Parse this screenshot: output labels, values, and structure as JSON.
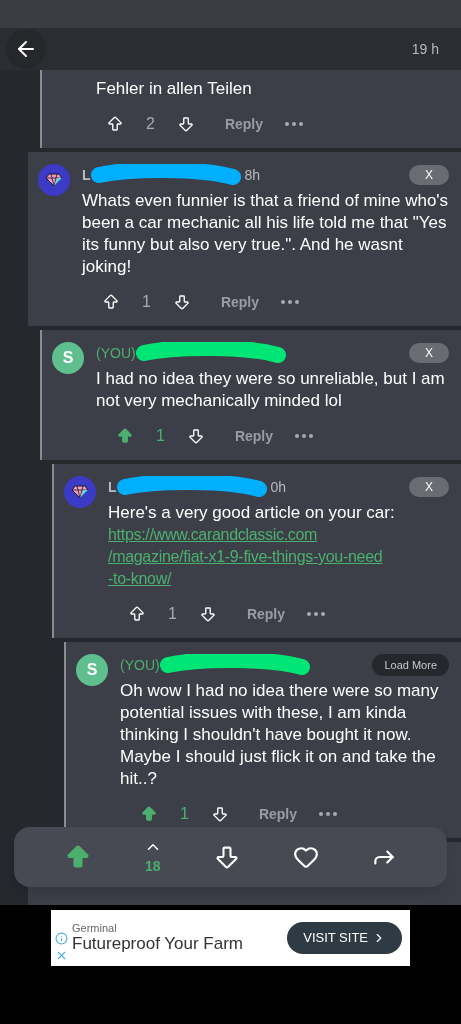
{
  "header": {
    "time": "19 h"
  },
  "earlier_thread": {
    "children": [
      {
        "text": "Fehler in allen Teilen",
        "votes": "2",
        "upvoted": false,
        "reply": "Reply"
      }
    ]
  },
  "comments": [
    {
      "avatar": {
        "kind": "diamond"
      },
      "author": "L",
      "time": "8h",
      "action": {
        "kind": "close",
        "label": "X"
      },
      "text": "Whats even funnier is that a friend of mine who's been a car mechanic all his life told me that \"Yes its funny but also very true.\". And he wasnt joking!",
      "votes": "1",
      "upvoted": false,
      "reply": "Reply",
      "children": [
        {
          "avatar": {
            "kind": "letter",
            "letter": "S"
          },
          "you_tag": "(YOU)",
          "action": {
            "kind": "close",
            "label": "X"
          },
          "text": "I had no idea they were so unreliable, but I am not very mechanically minded lol",
          "votes": "1",
          "upvoted": true,
          "reply": "Reply",
          "children": [
            {
              "avatar": {
                "kind": "diamond"
              },
              "author": "L",
              "time": "0h",
              "action": {
                "kind": "close",
                "label": "X"
              },
              "text": "Here's a very good article on your car:",
              "link_lines": [
                "https://www.carandclassic.com",
                "/magazine/fiat-x1-9-five-things-you-need",
                "-to-know/"
              ],
              "votes": "1",
              "upvoted": false,
              "reply": "Reply",
              "children": [
                {
                  "avatar": {
                    "kind": "letter",
                    "letter": "S"
                  },
                  "you_tag": "(YOU)",
                  "action": {
                    "kind": "load_more",
                    "label": "Load More"
                  },
                  "text": "Oh wow I had no idea there were so many potential issues with these, I am kinda thinking I shouldn't have bought it now. Maybe I should just flick it on and take the hit..?",
                  "votes": "1",
                  "upvoted": true,
                  "reply": "Reply"
                }
              ]
            }
          ]
        }
      ]
    }
  ],
  "post_bar": {
    "votes": "18",
    "upvoted": true,
    "liked": false
  },
  "ad": {
    "sponsor": "Germinal",
    "headline": "Futureproof Your Farm",
    "cta": "VISIT SITE"
  }
}
